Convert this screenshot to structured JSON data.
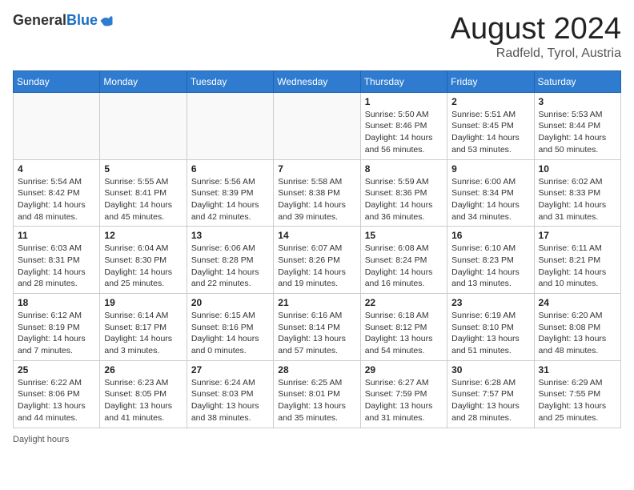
{
  "header": {
    "logo_general": "General",
    "logo_blue": "Blue",
    "month_title": "August 2024",
    "location": "Radfeld, Tyrol, Austria"
  },
  "days_of_week": [
    "Sunday",
    "Monday",
    "Tuesday",
    "Wednesday",
    "Thursday",
    "Friday",
    "Saturday"
  ],
  "weeks": [
    [
      {
        "day": "",
        "info": ""
      },
      {
        "day": "",
        "info": ""
      },
      {
        "day": "",
        "info": ""
      },
      {
        "day": "",
        "info": ""
      },
      {
        "day": "1",
        "info": "Sunrise: 5:50 AM\nSunset: 8:46 PM\nDaylight: 14 hours and 56 minutes."
      },
      {
        "day": "2",
        "info": "Sunrise: 5:51 AM\nSunset: 8:45 PM\nDaylight: 14 hours and 53 minutes."
      },
      {
        "day": "3",
        "info": "Sunrise: 5:53 AM\nSunset: 8:44 PM\nDaylight: 14 hours and 50 minutes."
      }
    ],
    [
      {
        "day": "4",
        "info": "Sunrise: 5:54 AM\nSunset: 8:42 PM\nDaylight: 14 hours and 48 minutes."
      },
      {
        "day": "5",
        "info": "Sunrise: 5:55 AM\nSunset: 8:41 PM\nDaylight: 14 hours and 45 minutes."
      },
      {
        "day": "6",
        "info": "Sunrise: 5:56 AM\nSunset: 8:39 PM\nDaylight: 14 hours and 42 minutes."
      },
      {
        "day": "7",
        "info": "Sunrise: 5:58 AM\nSunset: 8:38 PM\nDaylight: 14 hours and 39 minutes."
      },
      {
        "day": "8",
        "info": "Sunrise: 5:59 AM\nSunset: 8:36 PM\nDaylight: 14 hours and 36 minutes."
      },
      {
        "day": "9",
        "info": "Sunrise: 6:00 AM\nSunset: 8:34 PM\nDaylight: 14 hours and 34 minutes."
      },
      {
        "day": "10",
        "info": "Sunrise: 6:02 AM\nSunset: 8:33 PM\nDaylight: 14 hours and 31 minutes."
      }
    ],
    [
      {
        "day": "11",
        "info": "Sunrise: 6:03 AM\nSunset: 8:31 PM\nDaylight: 14 hours and 28 minutes."
      },
      {
        "day": "12",
        "info": "Sunrise: 6:04 AM\nSunset: 8:30 PM\nDaylight: 14 hours and 25 minutes."
      },
      {
        "day": "13",
        "info": "Sunrise: 6:06 AM\nSunset: 8:28 PM\nDaylight: 14 hours and 22 minutes."
      },
      {
        "day": "14",
        "info": "Sunrise: 6:07 AM\nSunset: 8:26 PM\nDaylight: 14 hours and 19 minutes."
      },
      {
        "day": "15",
        "info": "Sunrise: 6:08 AM\nSunset: 8:24 PM\nDaylight: 14 hours and 16 minutes."
      },
      {
        "day": "16",
        "info": "Sunrise: 6:10 AM\nSunset: 8:23 PM\nDaylight: 14 hours and 13 minutes."
      },
      {
        "day": "17",
        "info": "Sunrise: 6:11 AM\nSunset: 8:21 PM\nDaylight: 14 hours and 10 minutes."
      }
    ],
    [
      {
        "day": "18",
        "info": "Sunrise: 6:12 AM\nSunset: 8:19 PM\nDaylight: 14 hours and 7 minutes."
      },
      {
        "day": "19",
        "info": "Sunrise: 6:14 AM\nSunset: 8:17 PM\nDaylight: 14 hours and 3 minutes."
      },
      {
        "day": "20",
        "info": "Sunrise: 6:15 AM\nSunset: 8:16 PM\nDaylight: 14 hours and 0 minutes."
      },
      {
        "day": "21",
        "info": "Sunrise: 6:16 AM\nSunset: 8:14 PM\nDaylight: 13 hours and 57 minutes."
      },
      {
        "day": "22",
        "info": "Sunrise: 6:18 AM\nSunset: 8:12 PM\nDaylight: 13 hours and 54 minutes."
      },
      {
        "day": "23",
        "info": "Sunrise: 6:19 AM\nSunset: 8:10 PM\nDaylight: 13 hours and 51 minutes."
      },
      {
        "day": "24",
        "info": "Sunrise: 6:20 AM\nSunset: 8:08 PM\nDaylight: 13 hours and 48 minutes."
      }
    ],
    [
      {
        "day": "25",
        "info": "Sunrise: 6:22 AM\nSunset: 8:06 PM\nDaylight: 13 hours and 44 minutes."
      },
      {
        "day": "26",
        "info": "Sunrise: 6:23 AM\nSunset: 8:05 PM\nDaylight: 13 hours and 41 minutes."
      },
      {
        "day": "27",
        "info": "Sunrise: 6:24 AM\nSunset: 8:03 PM\nDaylight: 13 hours and 38 minutes."
      },
      {
        "day": "28",
        "info": "Sunrise: 6:25 AM\nSunset: 8:01 PM\nDaylight: 13 hours and 35 minutes."
      },
      {
        "day": "29",
        "info": "Sunrise: 6:27 AM\nSunset: 7:59 PM\nDaylight: 13 hours and 31 minutes."
      },
      {
        "day": "30",
        "info": "Sunrise: 6:28 AM\nSunset: 7:57 PM\nDaylight: 13 hours and 28 minutes."
      },
      {
        "day": "31",
        "info": "Sunrise: 6:29 AM\nSunset: 7:55 PM\nDaylight: 13 hours and 25 minutes."
      }
    ]
  ],
  "footer": {
    "daylight_label": "Daylight hours"
  }
}
